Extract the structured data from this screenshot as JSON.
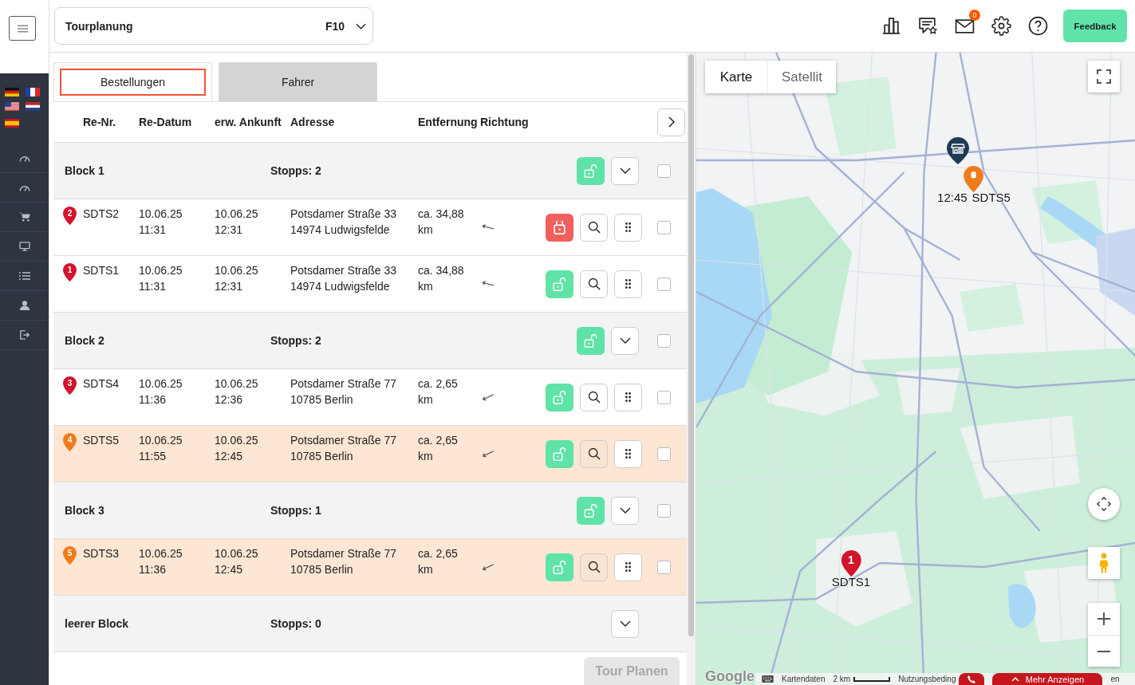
{
  "header": {
    "module_select": {
      "label": "Tourplanung",
      "shortcut": "F10"
    },
    "mail_badge": "0",
    "feedback": "Feedback"
  },
  "tabs": [
    {
      "label": "Bestellungen",
      "selected": true
    },
    {
      "label": "Fahrer",
      "selected": false
    }
  ],
  "table": {
    "columns": [
      "Re-Nr.",
      "Re-Datum",
      "erw. Ankunft",
      "Adresse",
      "Entfernung",
      "Richtung"
    ],
    "rows": [
      {
        "kind": "block",
        "label": "Block 1",
        "stops": "Stopps: 2",
        "locked": false,
        "checked": false
      },
      {
        "kind": "order",
        "number": "2",
        "color": "#d4132c",
        "id": "SDTS2",
        "date": "10.06.25 11:31",
        "arrival": "10.06.25 12:31",
        "address": "Potsdamer Straße 33 14974 Ludwigsfelde",
        "distance": "ca. 34,88 km",
        "arrow_downward": false,
        "locked": true,
        "highlighted": false,
        "checked": false
      },
      {
        "kind": "order",
        "number": "1",
        "color": "#d4132c",
        "id": "SDTS1",
        "date": "10.06.25 11:31",
        "arrival": "10.06.25 12:31",
        "address": "Potsdamer Straße 33 14974 Ludwigsfelde",
        "distance": "ca. 34,88 km",
        "arrow_downward": false,
        "locked": false,
        "highlighted": false,
        "checked": false
      },
      {
        "kind": "block",
        "label": "Block 2",
        "stops": "Stopps: 2",
        "locked": false,
        "checked": false
      },
      {
        "kind": "order",
        "number": "3",
        "color": "#d4132c",
        "id": "SDTS4",
        "date": "10.06.25 11:36",
        "arrival": "10.06.25 12:36",
        "address": "Potsdamer Straße 77 10785 Berlin",
        "distance": "ca. 2,65 km",
        "arrow_downward": true,
        "locked": false,
        "highlighted": false,
        "checked": false
      },
      {
        "kind": "order",
        "number": "4",
        "color": "#f07b1a",
        "id": "SDTS5",
        "date": "10.06.25 11:55",
        "arrival": "10.06.25 12:45",
        "address": "Potsdamer Straße 77 10785 Berlin",
        "distance": "ca. 2,65 km",
        "arrow_downward": true,
        "locked": false,
        "highlighted": true,
        "checked": false
      },
      {
        "kind": "block",
        "label": "Block 3",
        "stops": "Stopps: 1",
        "locked": false,
        "checked": false
      },
      {
        "kind": "order",
        "number": "5",
        "color": "#f07b1a",
        "id": "SDTS3",
        "date": "10.06.25 11:36",
        "arrival": "10.06.25 12:45",
        "address": "Potsdamer Straße 77 10785 Berlin",
        "distance": "ca. 2,65 km",
        "arrow_downward": true,
        "locked": false,
        "highlighted": true,
        "checked": false
      },
      {
        "kind": "empty",
        "label": "leerer Block",
        "stops": "Stopps: 0"
      }
    ]
  },
  "tour_button": {
    "label": "Tour Planen",
    "disabled": true
  },
  "map": {
    "types": [
      {
        "label": "Karte",
        "selected": true
      },
      {
        "label": "Satellit",
        "selected": false
      }
    ],
    "markers": [
      {
        "kind": "depot",
        "color": "#1f3a56"
      },
      {
        "kind": "stack",
        "color": "#f07b1a",
        "labels": [
          "12:45",
          "SDTS5"
        ]
      },
      {
        "kind": "stop",
        "color": "#d4132c",
        "number": "1",
        "labels": [
          "SDTS1"
        ]
      }
    ],
    "logo": "Google",
    "map_data": "Kartendaten",
    "scale": "2 km",
    "terms": "Nutzungsbeding",
    "more_button": "Mehr Anzeigen",
    "link_fragment": "en"
  }
}
